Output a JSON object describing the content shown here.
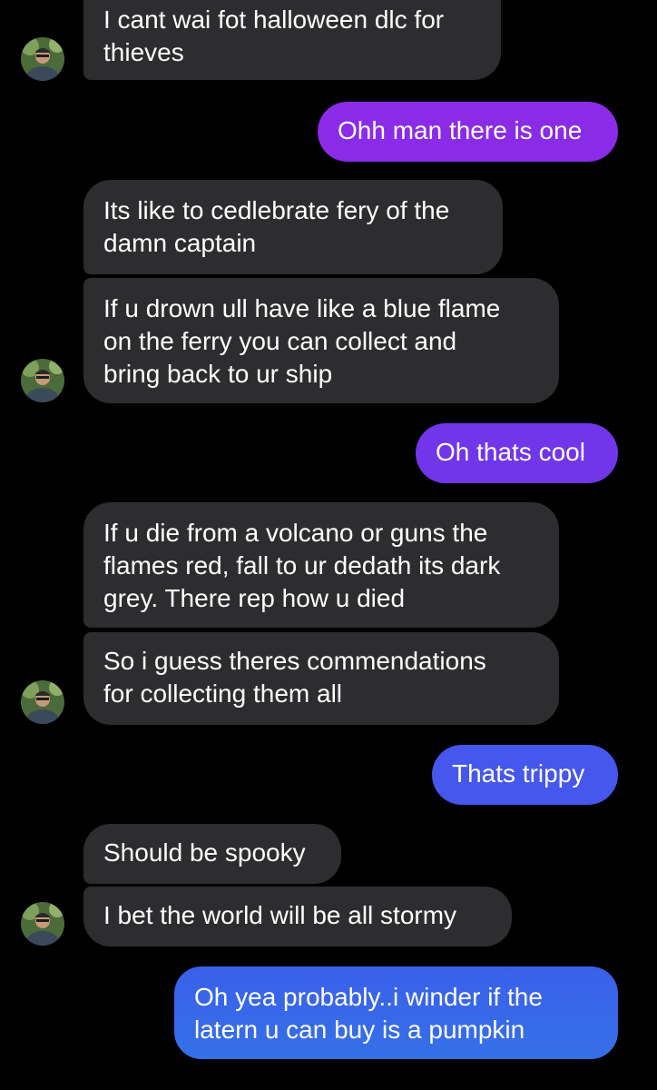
{
  "colors": {
    "background": "#000000",
    "incoming_bubble": "#2d2d2f",
    "outgoing_gradient": [
      "#8a2be8",
      "#7136ea",
      "#5a46ec",
      "#4557ec",
      "#3a60ea",
      "#3570e8"
    ]
  },
  "messages": [
    {
      "id": "m1",
      "direction": "incoming",
      "text": "I cant wai fot halloween dlc for\nthieves"
    },
    {
      "id": "m2",
      "direction": "outgoing",
      "text": "Ohh man there is one"
    },
    {
      "id": "m3",
      "direction": "incoming",
      "text": "Its like to cedlebrate fery of the\ndamn captain"
    },
    {
      "id": "m4",
      "direction": "incoming",
      "text": "If u drown ull have like a blue flame\non the ferry you can collect and\nbring back to ur ship"
    },
    {
      "id": "m5",
      "direction": "outgoing",
      "text": "Oh thats cool"
    },
    {
      "id": "m6",
      "direction": "incoming",
      "text": "If u die from a volcano or guns the\nflames red, fall to ur dedath its dark\ngrey. There rep how u died"
    },
    {
      "id": "m7",
      "direction": "incoming",
      "text": "So i guess theres commendations\nfor collecting them all"
    },
    {
      "id": "m8",
      "direction": "outgoing",
      "text": "Thats trippy"
    },
    {
      "id": "m9",
      "direction": "incoming",
      "text": "Should be spooky"
    },
    {
      "id": "m10",
      "direction": "incoming",
      "text": "I bet the world will be all stormy"
    },
    {
      "id": "m11",
      "direction": "outgoing",
      "text": "Oh yea probably..i winder if the\nlatern u can buy is a pumpkin"
    }
  ]
}
